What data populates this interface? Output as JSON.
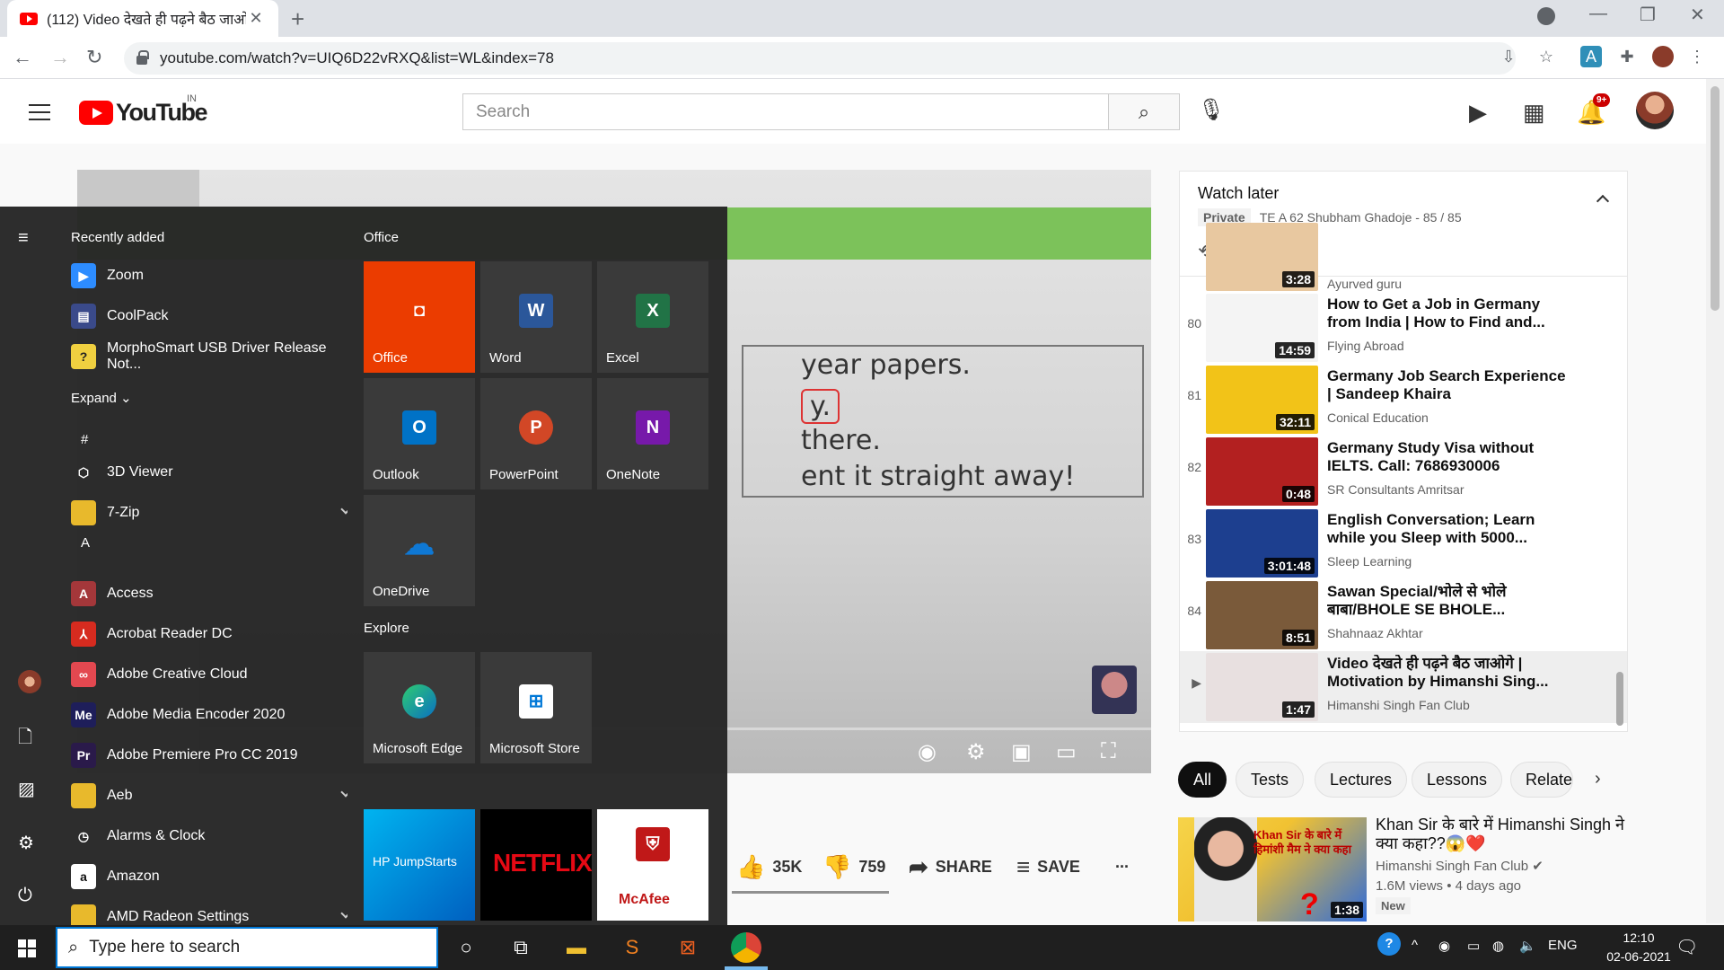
{
  "browser": {
    "tab_title": "(112) Video देखते ही पढ़ने बैठ जाओ",
    "tab_close": "✕",
    "new_tab": "+",
    "url": "youtube.com/watch?v=UIQ6D22vRXQ&list=WL&index=78"
  },
  "youtube": {
    "logo": "YouTube",
    "country": "IN",
    "search_placeholder": "Search",
    "notif_count": "9+"
  },
  "video": {
    "slide_lines": [
      "year papers.",
      "y.",
      "there.",
      "ent it straight away!"
    ]
  },
  "actions": {
    "likes": "35K",
    "dislikes": "759",
    "share": "SHARE",
    "save": "SAVE",
    "more": "..."
  },
  "watch_later": {
    "title": "Watch later",
    "privacy": "Private",
    "owner_count": "TE A 62 Shubham Ghadoje - 85 / 85",
    "partial": {
      "duration": "3:28",
      "channel": "Ayurved guru"
    },
    "items": [
      {
        "index": "80",
        "title": "How to Get a Job in Germany from India | How to Find and...",
        "channel": "Flying Abroad",
        "duration": "14:59",
        "thumb_color": "#f4f4f4"
      },
      {
        "index": "81",
        "title": "Germany Job Search Experience | Sandeep Khaira",
        "channel": "Conical Education",
        "duration": "32:11",
        "thumb_color": "#f2c318"
      },
      {
        "index": "82",
        "title": "Germany Study Visa without IELTS. Call: 7686930006",
        "channel": "SR Consultants Amritsar",
        "duration": "0:48",
        "thumb_color": "#b32020"
      },
      {
        "index": "83",
        "title": "English Conversation; Learn while you Sleep with 5000...",
        "channel": "Sleep Learning",
        "duration": "3:01:48",
        "thumb_color": "#1d3f8f"
      },
      {
        "index": "84",
        "title": "Sawan Special/भोले से भोले बाबा/BHOLE SE BHOLE...",
        "channel": "Shahnaaz Akhtar",
        "duration": "8:51",
        "thumb_color": "#7a5a3a"
      },
      {
        "index": "▶",
        "title": "Video देखते ही पढ़ने बैठ जाओगे | Motivation by Himanshi Sing...",
        "channel": "Himanshi Singh Fan Club",
        "duration": "1:47",
        "thumb_color": "#e8e0e0"
      }
    ]
  },
  "chips": [
    "All",
    "Tests",
    "Lectures",
    "Lessons",
    "Relate"
  ],
  "recommendation": {
    "title": "Khan Sir के बारे में Himanshi Singh ने क्या कहा??😱❤️",
    "channel": "Himanshi Singh Fan Club ✔",
    "meta": "1.6M views • 4 days ago",
    "badge": "New",
    "duration": "1:38",
    "thumb_text": "Khan Sir के बारे में हिमांशी मैम ने क्या कहा"
  },
  "start_menu": {
    "recently_added": "Recently added",
    "recent": [
      "Zoom",
      "CoolPack",
      "MorphoSmart USB Driver Release Not..."
    ],
    "expand": "Expand",
    "hash": "#",
    "letter_a": "A",
    "apps": [
      {
        "name": "3D Viewer",
        "icon": "3d-viewer-icon",
        "color": "transparent",
        "glyph": "⬡"
      },
      {
        "name": "7-Zip",
        "icon": "folder-icon",
        "color": "#e8b92c",
        "glyph": "",
        "chev": true
      },
      {
        "name": "Access",
        "icon": "access-icon",
        "color": "#a4373a",
        "glyph": "A"
      },
      {
        "name": "Acrobat Reader DC",
        "icon": "acrobat-icon",
        "color": "#d62b1f",
        "glyph": "⅄"
      },
      {
        "name": "Adobe Creative Cloud",
        "icon": "creative-cloud-icon",
        "color": "#e34850",
        "glyph": "∞"
      },
      {
        "name": "Adobe Media Encoder 2020",
        "icon": "media-encoder-icon",
        "color": "#1e1e5a",
        "glyph": "Me"
      },
      {
        "name": "Adobe Premiere Pro CC 2019",
        "icon": "premiere-icon",
        "color": "#2a1a4a",
        "glyph": "Pr"
      },
      {
        "name": "Aeb",
        "icon": "folder-icon",
        "color": "#e8b92c",
        "glyph": "",
        "chev": true
      },
      {
        "name": "Alarms & Clock",
        "icon": "clock-icon",
        "color": "transparent",
        "glyph": "◷"
      },
      {
        "name": "Amazon",
        "icon": "amazon-icon",
        "color": "#ffffff",
        "glyph": "a"
      },
      {
        "name": "AMD Radeon Settings",
        "icon": "folder-icon",
        "color": "#e8b92c",
        "glyph": "",
        "chev": true
      }
    ],
    "office_header": "Office",
    "explore_header": "Explore",
    "tiles": {
      "office": "Office",
      "word": "Word",
      "excel": "Excel",
      "outlook": "Outlook",
      "powerpoint": "PowerPoint",
      "onenote": "OneNote",
      "onedrive": "OneDrive",
      "edge": "Microsoft Edge",
      "store": "Microsoft Store",
      "hp": "HP JumpStarts",
      "netflix": "NETFLIX",
      "mcafee": "McAfee"
    }
  },
  "taskbar": {
    "search_placeholder": "Type here to search",
    "lang": "ENG",
    "time": "12:10",
    "date": "02-06-2021"
  }
}
